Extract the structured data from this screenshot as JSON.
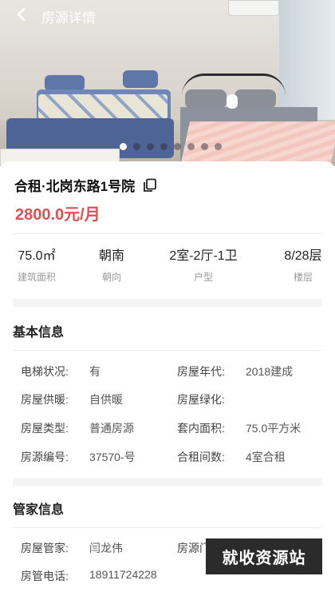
{
  "header": {
    "title": "房源详情"
  },
  "gallery": {
    "dot_count": 8,
    "active_index": 0
  },
  "listing": {
    "title": "合租·北岗东路1号院",
    "price": "2800.0元/月"
  },
  "stats": [
    {
      "value": "75.0㎡",
      "label": "建筑面积"
    },
    {
      "value": "朝南",
      "label": "朝向"
    },
    {
      "value": "2室-2厅-1卫",
      "label": "户型"
    },
    {
      "value": "8/28层",
      "label": "楼层"
    }
  ],
  "basic_info": {
    "title": "基本信息",
    "rows": [
      {
        "k1": "电梯状况:",
        "v1": "有",
        "k2": "房屋年代:",
        "v2": "2018建成"
      },
      {
        "k1": "房屋供暖:",
        "v1": "自供暖",
        "k2": "房屋绿化:",
        "v2": ""
      },
      {
        "k1": "房屋类型:",
        "v1": "普通房源",
        "k2": "套内面积:",
        "v2": "75.0平方米"
      },
      {
        "k1": "房源编号:",
        "v1": "37570-号",
        "k2": "合租间数:",
        "v2": "4室合租"
      }
    ]
  },
  "manager_info": {
    "title": "管家信息",
    "rows": [
      {
        "k1": "房屋管家:",
        "v1": "闫龙伟",
        "k2": "房源门",
        "v2": ""
      },
      {
        "k1": "房管电话:",
        "v1": "18911724228"
      }
    ]
  },
  "watermark": "就收资源站",
  "colors": {
    "price": "#d9534f",
    "accent_dot": "#ffffff"
  }
}
